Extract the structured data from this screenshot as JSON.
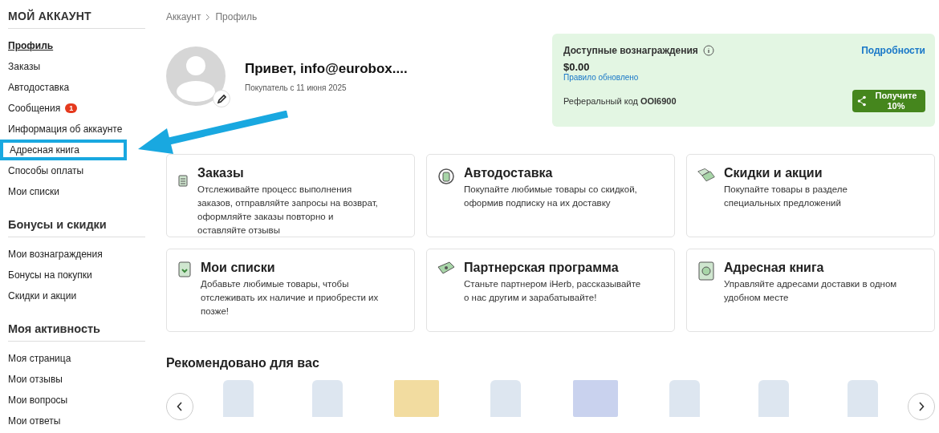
{
  "sidebar": {
    "sections": [
      {
        "kind": "caps",
        "title": "МОЙ АККАУНТ",
        "items": [
          {
            "label": "Профиль",
            "selected": true,
            "highlighted": false
          },
          {
            "label": "Заказы",
            "selected": false,
            "highlighted": false
          },
          {
            "label": "Автодоставка",
            "selected": false,
            "highlighted": false
          },
          {
            "label": "Сообщения",
            "selected": false,
            "highlighted": false,
            "badge": "1"
          },
          {
            "label": "Информация об аккаунте",
            "selected": false,
            "highlighted": false
          },
          {
            "label": "Адресная книга",
            "selected": false,
            "highlighted": true
          },
          {
            "label": "Способы оплаты",
            "selected": false,
            "highlighted": false
          },
          {
            "label": "Мои списки",
            "selected": false,
            "highlighted": false
          }
        ]
      },
      {
        "kind": "plain",
        "title": "Бонусы и скидки",
        "items": [
          {
            "label": "Мои вознаграждения",
            "selected": false,
            "highlighted": false
          },
          {
            "label": "Бонусы на покупки",
            "selected": false,
            "highlighted": false
          },
          {
            "label": "Скидки и акции",
            "selected": false,
            "highlighted": false
          }
        ]
      },
      {
        "kind": "plain",
        "title": "Моя активность",
        "items": [
          {
            "label": "Моя страница",
            "selected": false,
            "highlighted": false
          },
          {
            "label": "Мои отзывы",
            "selected": false,
            "highlighted": false
          },
          {
            "label": "Мои вопросы",
            "selected": false,
            "highlighted": false
          },
          {
            "label": "Мои ответы",
            "selected": false,
            "highlighted": false
          }
        ]
      }
    ]
  },
  "breadcrumbs": [
    "Аккаунт",
    "Профиль"
  ],
  "profile": {
    "greeting": "Привет, info@eurobox....",
    "since": "Покупатель с 11 июня 2025"
  },
  "rewards": {
    "title": "Доступные вознаграждения",
    "details_link": "Подробности",
    "amount": "$0.00",
    "rule_link": "Правило обновлено",
    "referral_label": "Реферальный код",
    "referral_code": "OOI6900",
    "share_button": "Получите 10%"
  },
  "cards": [
    {
      "kind": "orders",
      "title": "Заказы",
      "text": "Отслеживайте процесс выполнения заказов, отправляйте запросы на возврат, оформляйте заказы повторно и оставляйте отзывы"
    },
    {
      "kind": "autoship",
      "title": "Автодоставка",
      "text": "Покупайте любимые товары со скидкой, оформив подписку на их доставку"
    },
    {
      "kind": "sale",
      "title": "Скидки и акции",
      "text": "Покупайте товары в разделе специальных предложений"
    },
    {
      "kind": "lists",
      "title": "Мои списки",
      "text": "Добавьте любимые товары, чтобы отслеживать их наличие и приобрести их позже!"
    },
    {
      "kind": "partner",
      "title": "Партнерская программа",
      "text": "Станьте партнером iHerb, рассказывайте о нас другим и зарабатывайте!"
    },
    {
      "kind": "address",
      "title": "Адресная книга",
      "text": "Управляйте адресами доставки в одном удобном месте"
    }
  ],
  "recommended": {
    "title": "Рекомендовано для вас",
    "products": [
      {
        "kind": "bottle"
      },
      {
        "kind": "bottle"
      },
      {
        "kind": "pouch"
      },
      {
        "kind": "bottle"
      },
      {
        "kind": "box"
      },
      {
        "kind": "bottle"
      },
      {
        "kind": "bottle"
      },
      {
        "kind": "bottle"
      }
    ]
  }
}
